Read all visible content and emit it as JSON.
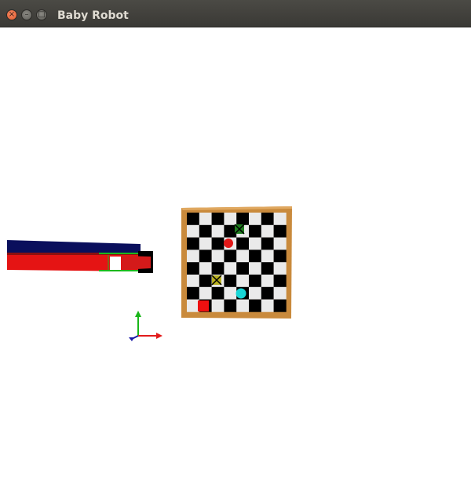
{
  "window": {
    "title": "Baby Robot",
    "close_glyph": "×",
    "minimize_glyph": "–",
    "maximize_glyph": "□"
  },
  "scene": {
    "board": {
      "grid_size": 8,
      "frame_color": "#c98a3c",
      "dark_square_color": "#000000",
      "light_square_color": "#eaeaea",
      "pieces": [
        {
          "name": "green-x-marker",
          "shape": "x-square",
          "color": "#1f7d1f"
        },
        {
          "name": "red-ball",
          "shape": "circle",
          "color": "#e01818"
        },
        {
          "name": "yellow-x-marker",
          "shape": "x-square",
          "color": "#b8b020"
        },
        {
          "name": "cyan-ball",
          "shape": "circle",
          "color": "#18d6d6"
        },
        {
          "name": "red-block",
          "shape": "square",
          "color": "#ee1010"
        }
      ]
    },
    "robot_arm": {
      "colors": [
        "#0a0f5c",
        "#e51414",
        "#000000",
        "#1db81d"
      ]
    },
    "axes": {
      "colors": {
        "x": "#e21b1b",
        "y": "#19b619",
        "z": "#1a1aa8"
      }
    }
  }
}
